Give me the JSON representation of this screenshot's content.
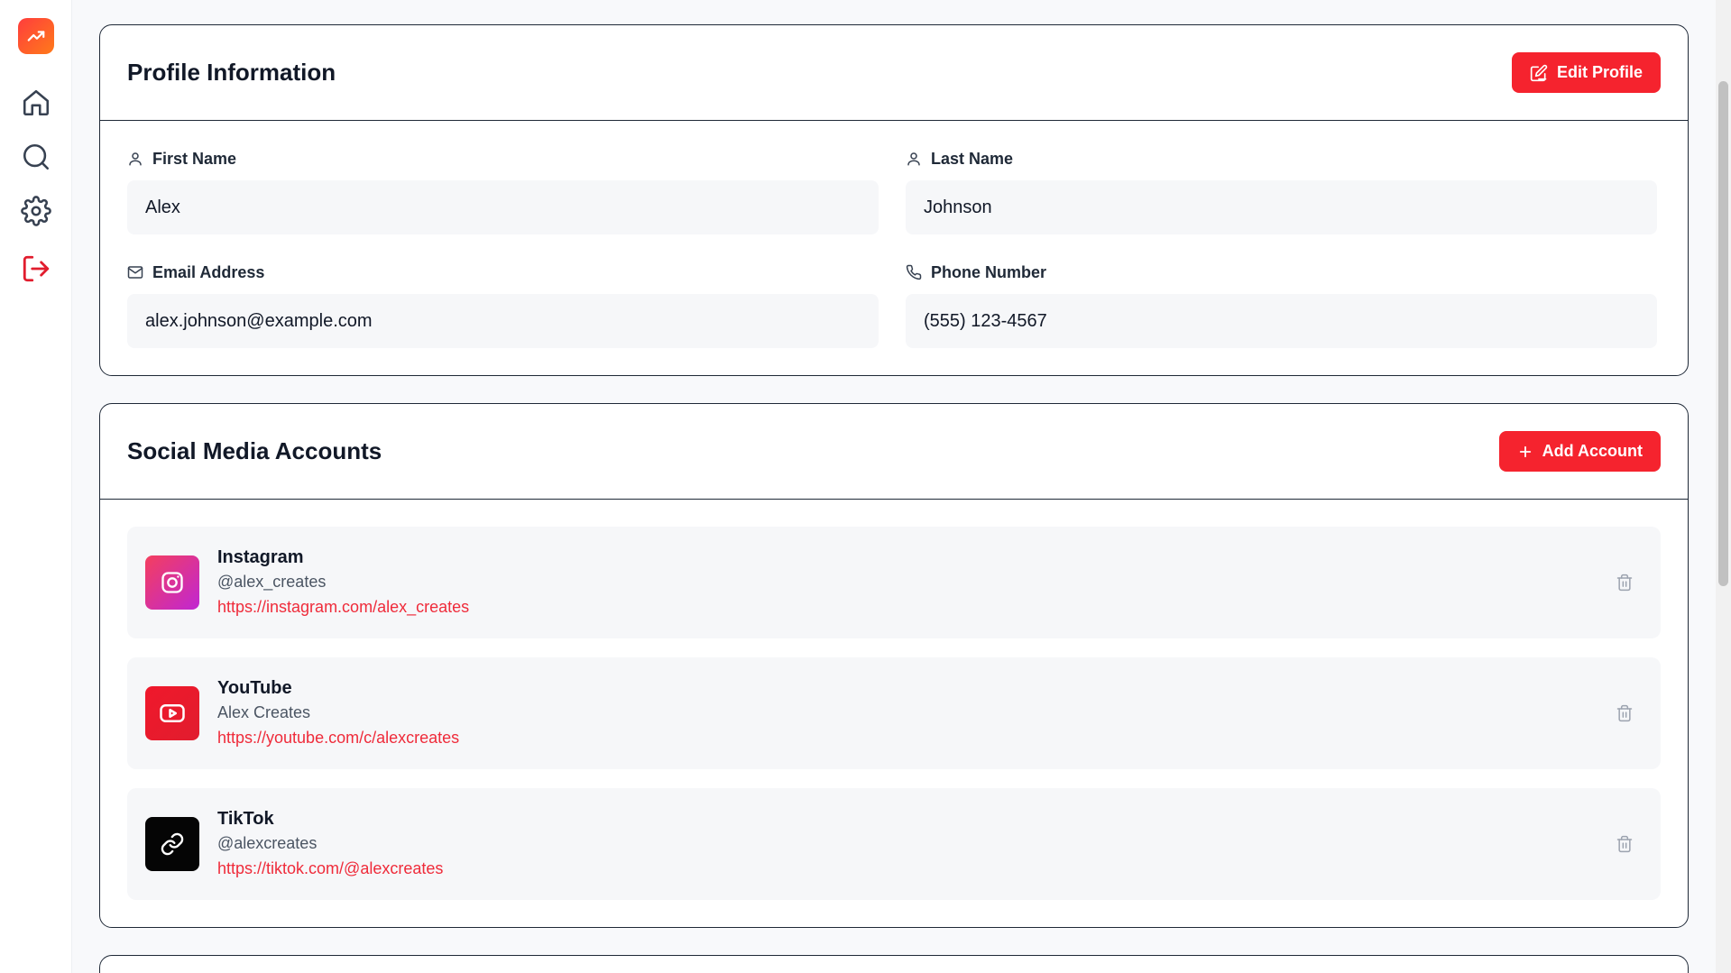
{
  "sidebar": {
    "logo": "trending-up-icon",
    "items": [
      {
        "name": "home",
        "icon": "home-icon"
      },
      {
        "name": "search",
        "icon": "search-icon"
      },
      {
        "name": "settings",
        "icon": "gear-icon"
      },
      {
        "name": "logout",
        "icon": "logout-icon"
      }
    ]
  },
  "colors": {
    "accent": "#f5232e",
    "link": "#ef2b3a",
    "instagram_gradient": [
      "#f43f5e",
      "#c026d3"
    ],
    "youtube": "#ef1c2c",
    "tiktok": "#000000"
  },
  "profile": {
    "title": "Profile Information",
    "edit_button": "Edit Profile",
    "fields": {
      "first_name": {
        "label": "First Name",
        "value": "Alex"
      },
      "last_name": {
        "label": "Last Name",
        "value": "Johnson"
      },
      "email": {
        "label": "Email Address",
        "value": "alex.johnson@example.com"
      },
      "phone": {
        "label": "Phone Number",
        "value": "(555) 123-4567"
      }
    }
  },
  "social": {
    "title": "Social Media Accounts",
    "add_button": "Add Account",
    "accounts": [
      {
        "platform": "Instagram",
        "handle": "@alex_creates",
        "url": "https://instagram.com/alex_creates",
        "icon": "instagram-icon"
      },
      {
        "platform": "YouTube",
        "handle": "Alex Creates",
        "url": "https://youtube.com/c/alexcreates",
        "icon": "youtube-icon"
      },
      {
        "platform": "TikTok",
        "handle": "@alexcreates",
        "url": "https://tiktok.com/@alexcreates",
        "icon": "link-icon"
      }
    ]
  }
}
